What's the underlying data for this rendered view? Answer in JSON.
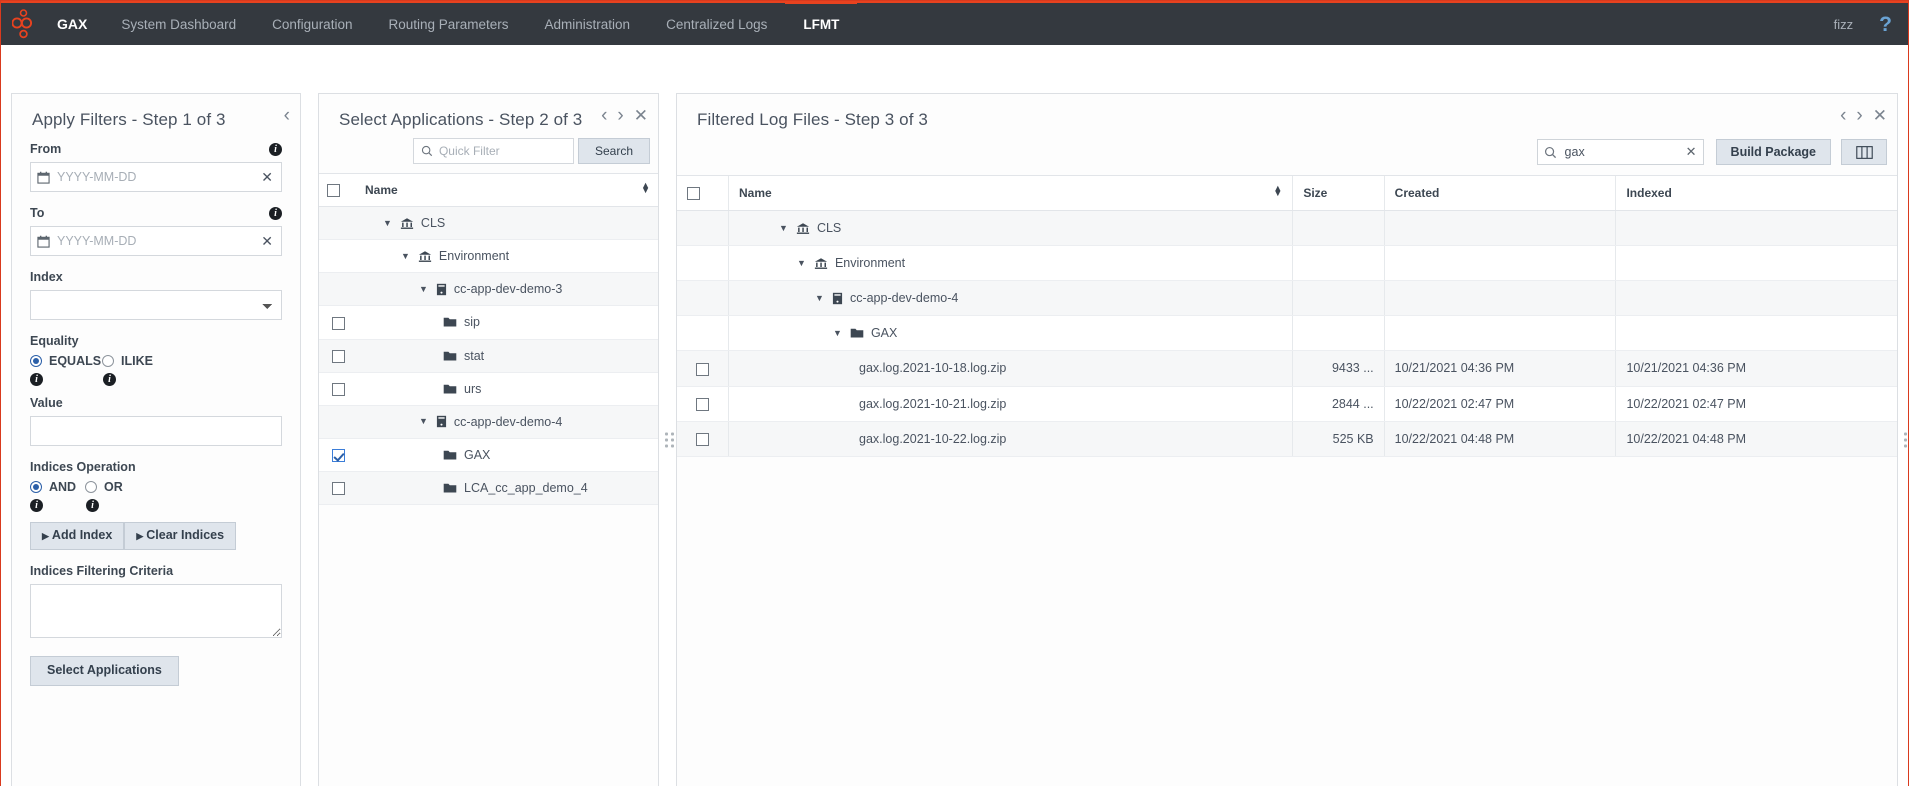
{
  "nav": {
    "brand": "GAX",
    "items": [
      {
        "label": "System Dashboard",
        "active": false
      },
      {
        "label": "Configuration",
        "active": false
      },
      {
        "label": "Routing Parameters",
        "active": false
      },
      {
        "label": "Administration",
        "active": false
      },
      {
        "label": "Centralized Logs",
        "active": false
      },
      {
        "label": "LFMT",
        "active": true
      }
    ],
    "user": "fizz",
    "help": "?",
    "accent": "#e8421f",
    "bg": "#34393f"
  },
  "panel1": {
    "title": "Apply Filters - Step 1 of 3",
    "collapse_icon": "chevron-left-icon",
    "from_label": "From",
    "from_placeholder": "YYYY-MM-DD",
    "from_value": "",
    "to_label": "To",
    "to_placeholder": "YYYY-MM-DD",
    "to_value": "",
    "index_label": "Index",
    "index_value": "",
    "equality_label": "Equality",
    "equality_options": [
      "EQUALS",
      "ILIKE"
    ],
    "equality_selected": "EQUALS",
    "value_label": "Value",
    "value_value": "",
    "indices_op_label": "Indices Operation",
    "indices_op_options": [
      "AND",
      "OR"
    ],
    "indices_op_selected": "AND",
    "add_index_label": "Add Index",
    "clear_indices_label": "Clear Indices",
    "criteria_label": "Indices Filtering Criteria",
    "criteria_value": "",
    "select_apps_label": "Select Applications",
    "clear_icon": "close-icon",
    "calendar_icon": "calendar-icon"
  },
  "panel2": {
    "title": "Select Applications - Step 2 of 3",
    "prev_icon": "chevron-left-icon",
    "next_icon": "chevron-right-icon",
    "close_icon": "close-icon",
    "quick_filter_placeholder": "Quick Filter",
    "quick_filter_value": "",
    "search_label": "Search",
    "search_icon": "search-icon",
    "header_name": "Name",
    "sort_icon": "sort-icon",
    "header_checkbox": false,
    "rows": [
      {
        "name": "CLS",
        "icon": "bank-icon",
        "indent": 0,
        "caret": "▼",
        "checkbox": null,
        "zebra": "odd"
      },
      {
        "name": "Environment",
        "icon": "bank-icon",
        "indent": 1,
        "caret": "▼",
        "checkbox": null,
        "zebra": "even"
      },
      {
        "name": "cc-app-dev-demo-3",
        "icon": "server-icon",
        "indent": 2,
        "caret": "▼",
        "checkbox": null,
        "zebra": "odd"
      },
      {
        "name": "sip",
        "icon": "folder-icon",
        "indent": 3,
        "caret": "",
        "checkbox": false,
        "zebra": "even"
      },
      {
        "name": "stat",
        "icon": "folder-icon",
        "indent": 3,
        "caret": "",
        "checkbox": false,
        "zebra": "odd"
      },
      {
        "name": "urs",
        "icon": "folder-icon",
        "indent": 3,
        "caret": "",
        "checkbox": false,
        "zebra": "even"
      },
      {
        "name": "cc-app-dev-demo-4",
        "icon": "server-icon",
        "indent": 2,
        "caret": "▼",
        "checkbox": null,
        "zebra": "odd"
      },
      {
        "name": "GAX",
        "icon": "folder-icon",
        "indent": 3,
        "caret": "",
        "checkbox": true,
        "zebra": "even"
      },
      {
        "name": "LCA_cc_app_demo_4",
        "icon": "folder-icon",
        "indent": 3,
        "caret": "",
        "checkbox": false,
        "zebra": "odd"
      }
    ]
  },
  "panel3": {
    "title": "Filtered Log Files - Step 3 of 3",
    "prev_icon": "chevron-left-icon",
    "next_icon": "chevron-right-icon",
    "close_icon": "close-icon",
    "search_value": "gax",
    "search_icon": "search-icon",
    "search_clear_icon": "close-icon",
    "build_package_label": "Build Package",
    "columns_icon": "columns-icon",
    "headers": {
      "name": "Name",
      "size": "Size",
      "created": "Created",
      "indexed": "Indexed"
    },
    "sort_icon": "sort-icon",
    "header_checkbox": false,
    "tree_rows": [
      {
        "name": "CLS",
        "icon": "bank-icon",
        "indent": 0,
        "caret": "▼",
        "zebra": "odd"
      },
      {
        "name": "Environment",
        "icon": "bank-icon",
        "indent": 1,
        "caret": "▼",
        "zebra": "even"
      },
      {
        "name": "cc-app-dev-demo-4",
        "icon": "server-icon",
        "indent": 2,
        "caret": "▼",
        "zebra": "odd"
      },
      {
        "name": "GAX",
        "icon": "folder-icon",
        "indent": 3,
        "caret": "▼",
        "zebra": "even"
      }
    ],
    "file_rows": [
      {
        "checkbox": false,
        "name": "gax.log.2021-10-18.log.zip",
        "size": "9433 ...",
        "created": "10/21/2021 04:36 PM",
        "indexed": "10/21/2021 04:36 PM",
        "zebra": "odd"
      },
      {
        "checkbox": false,
        "name": "gax.log.2021-10-21.log.zip",
        "size": "2844 ...",
        "created": "10/22/2021 02:47 PM",
        "indexed": "10/22/2021 02:47 PM",
        "zebra": "even"
      },
      {
        "checkbox": false,
        "name": "gax.log.2021-10-22.log.zip",
        "size": "525 KB",
        "created": "10/22/2021 04:48 PM",
        "indexed": "10/22/2021 04:48 PM",
        "zebra": "odd"
      }
    ]
  }
}
